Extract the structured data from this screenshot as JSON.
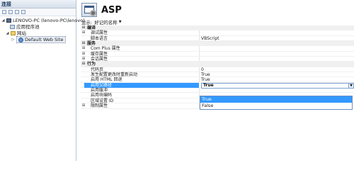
{
  "left": {
    "header": "连接",
    "tree": [
      {
        "label": "LENOVO-PC (lenovo-PC\\lenovo)",
        "toggle": "◢"
      },
      {
        "label": "应用程序池",
        "toggle": ""
      },
      {
        "label": "网站",
        "toggle": "◢"
      },
      {
        "label": "Default Web Site",
        "toggle": "▷"
      }
    ]
  },
  "main": {
    "title": "ASP",
    "display_label": "显示:",
    "display_value": "好记的名称"
  },
  "grid": {
    "rows": [
      {
        "name": "编译",
        "value": "",
        "toggle": "⊟"
      },
      {
        "name": "调试属性",
        "value": "",
        "toggle": "⊞"
      },
      {
        "name": "脚本语言",
        "value": "VBScript",
        "toggle": ""
      },
      {
        "name": "服务",
        "value": "",
        "toggle": "⊟"
      },
      {
        "name": "Com Plus 属性",
        "value": "",
        "toggle": "⊞"
      },
      {
        "name": "缓存属性",
        "value": "",
        "toggle": "⊞"
      },
      {
        "name": "会话属性",
        "value": "",
        "toggle": "⊞"
      },
      {
        "name": "行为",
        "value": "",
        "toggle": "⊟"
      },
      {
        "name": "代码页",
        "value": "0",
        "toggle": ""
      },
      {
        "name": "发生配置更改时重新启动",
        "value": "True",
        "toggle": ""
      },
      {
        "name": "启用 HTML 回退",
        "value": "True",
        "toggle": ""
      },
      {
        "name": "启用父路径",
        "value": "True",
        "toggle": ""
      },
      {
        "name": "启用缓冲",
        "value": "",
        "toggle": ""
      },
      {
        "name": "启用块编码",
        "value": "",
        "toggle": ""
      },
      {
        "name": "区域设置 ID",
        "value": "0",
        "toggle": ""
      },
      {
        "name": "限制属性",
        "value": "",
        "toggle": "⊞"
      }
    ],
    "dropdown_options": [
      "True",
      "False"
    ]
  },
  "colors": {
    "selection": "#3399ff",
    "category_bg": "#f0f0f0"
  }
}
